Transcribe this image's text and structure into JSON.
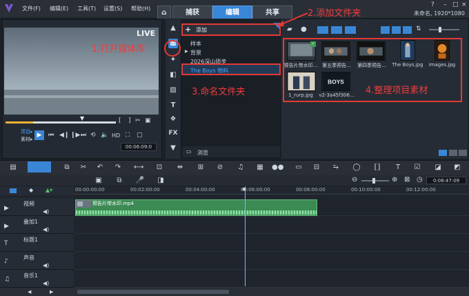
{
  "app": {
    "menus": [
      "文件(F)",
      "编辑(E)",
      "工具(T)",
      "设置(S)",
      "帮助(H)"
    ],
    "tabs": [
      "捕获",
      "编辑",
      "共享"
    ],
    "project_info": "未命名, 1920*1080"
  },
  "preview": {
    "live_label": "LIVE",
    "mode_project": "项目▸",
    "mode_clip": "素材▸",
    "hd_label": "HD",
    "timecode": "00:06:09:0"
  },
  "library": {
    "add_label": "添加",
    "folders": [
      "样本",
      "背景",
      "2026深山琐步",
      "The Boys 物料"
    ],
    "browse_label": "浏览",
    "thumbs": [
      "预告片带水印...",
      "第五季预告...",
      "第四季预告...",
      "The Boys.jpg",
      "images.jpg",
      "1_rurp.jpg",
      "v2-3a45f306..."
    ]
  },
  "annotations": {
    "step1": "1.打开媒体库",
    "step2": "2.添加文件夹",
    "step3": "3.命名文件夹",
    "step4": "4.整理项目素材"
  },
  "timeline": {
    "ticks": [
      "00:00:00:00",
      "00:02:00:00",
      "00:04:00:00",
      "00:06:00:00",
      "00:08:00:00",
      "00:10:00:00",
      "00:12:00:00"
    ],
    "tracks": [
      "视频",
      "叠加1",
      "标题1",
      "声音",
      "音乐1"
    ],
    "clip_label": "预告片带水印.mp4",
    "zoom_timecode": "0:08:47:09"
  },
  "colors": {
    "accent": "#3a86d6",
    "annotation": "#e53935",
    "clip": "#3c8a54"
  }
}
